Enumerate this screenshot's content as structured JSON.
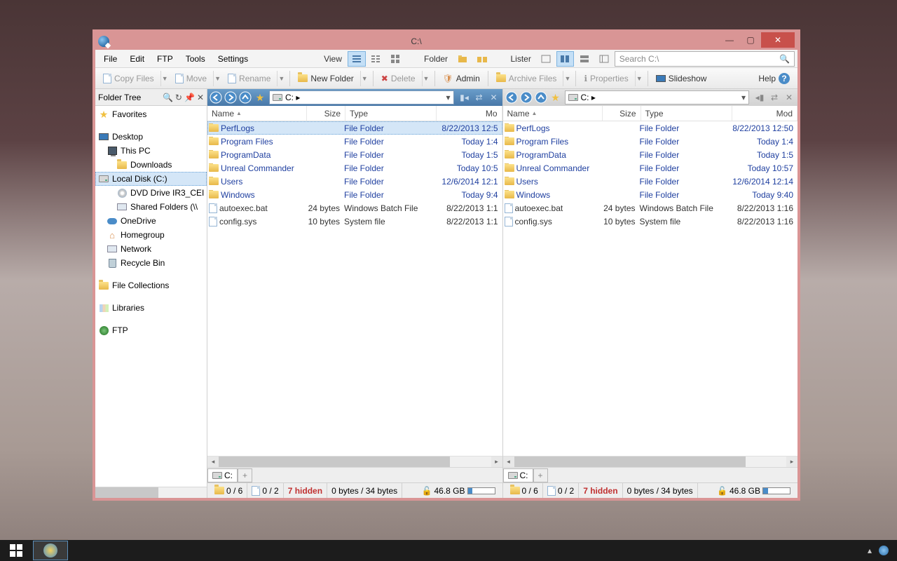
{
  "window": {
    "title": "C:\\"
  },
  "menubar": {
    "file": "File",
    "edit": "Edit",
    "ftp": "FTP",
    "tools": "Tools",
    "settings": "Settings",
    "view": "View",
    "folder": "Folder",
    "lister": "Lister"
  },
  "search": {
    "placeholder": "Search C:\\"
  },
  "toolbar": {
    "copy": "Copy Files",
    "move": "Move",
    "rename": "Rename",
    "newfolder": "New Folder",
    "delete": "Delete",
    "admin": "Admin",
    "archive": "Archive Files",
    "properties": "Properties",
    "slideshow": "Slideshow",
    "help": "Help"
  },
  "tree": {
    "header": "Folder Tree",
    "items": [
      {
        "label": "Favorites",
        "cls": "pad0",
        "icon": "star"
      },
      {
        "label": "",
        "cls": "blank"
      },
      {
        "label": "Desktop",
        "cls": "pad0",
        "icon": "desktop"
      },
      {
        "label": "This PC",
        "cls": "pad1",
        "icon": "pc"
      },
      {
        "label": "Downloads",
        "cls": "pad2",
        "icon": "folder"
      },
      {
        "label": "Local Disk (C:)",
        "cls": "pad2 sel",
        "icon": "drive"
      },
      {
        "label": "DVD Drive IR3_CEI",
        "cls": "pad2",
        "icon": "dvd"
      },
      {
        "label": "Shared Folders (\\\\",
        "cls": "pad2",
        "icon": "net"
      },
      {
        "label": "OneDrive",
        "cls": "pad1",
        "icon": "cloud"
      },
      {
        "label": "Homegroup",
        "cls": "pad1",
        "icon": "home"
      },
      {
        "label": "Network",
        "cls": "pad1",
        "icon": "net"
      },
      {
        "label": "Recycle Bin",
        "cls": "pad1",
        "icon": "bin"
      },
      {
        "label": "",
        "cls": "blank"
      },
      {
        "label": "File Collections",
        "cls": "pad0",
        "icon": "folder"
      },
      {
        "label": "",
        "cls": "blank"
      },
      {
        "label": "Libraries",
        "cls": "pad0",
        "icon": "lib"
      },
      {
        "label": "",
        "cls": "blank"
      },
      {
        "label": "FTP",
        "cls": "pad0",
        "icon": "ftp"
      }
    ]
  },
  "columns": {
    "name": "Name",
    "size": "Size",
    "type": "Type",
    "mod": "Mo"
  },
  "columns_r": {
    "mod": "Mod"
  },
  "address": "C: ▸",
  "files_left": [
    {
      "name": "PerfLogs",
      "size": "",
      "type": "File Folder",
      "mod": "8/22/2013  12:5",
      "folder": true,
      "link": true,
      "sel": true
    },
    {
      "name": "Program Files",
      "size": "",
      "type": "File Folder",
      "mod": "Today   1:4",
      "folder": true,
      "link": true
    },
    {
      "name": "ProgramData",
      "size": "",
      "type": "File Folder",
      "mod": "Today   1:5",
      "folder": true,
      "link": true
    },
    {
      "name": "Unreal Commander",
      "size": "",
      "type": "File Folder",
      "mod": "Today  10:5",
      "folder": true,
      "link": true
    },
    {
      "name": "Users",
      "size": "",
      "type": "File Folder",
      "mod": "12/6/2014  12:1",
      "folder": true,
      "link": true
    },
    {
      "name": "Windows",
      "size": "",
      "type": "File Folder",
      "mod": "Today   9:4",
      "folder": true,
      "link": true
    },
    {
      "name": "autoexec.bat",
      "size": "24 bytes",
      "type": "Windows Batch File",
      "mod": "8/22/2013   1:1",
      "folder": false,
      "link": false
    },
    {
      "name": "config.sys",
      "size": "10 bytes",
      "type": "System file",
      "mod": "8/22/2013   1:1",
      "folder": false,
      "link": false
    }
  ],
  "files_right": [
    {
      "name": "PerfLogs",
      "size": "",
      "type": "File Folder",
      "mod": "8/22/2013  12:50",
      "folder": true,
      "link": true
    },
    {
      "name": "Program Files",
      "size": "",
      "type": "File Folder",
      "mod": "Today   1:4",
      "folder": true,
      "link": true
    },
    {
      "name": "ProgramData",
      "size": "",
      "type": "File Folder",
      "mod": "Today   1:5",
      "folder": true,
      "link": true
    },
    {
      "name": "Unreal Commander",
      "size": "",
      "type": "File Folder",
      "mod": "Today  10:57",
      "folder": true,
      "link": true
    },
    {
      "name": "Users",
      "size": "",
      "type": "File Folder",
      "mod": "12/6/2014  12:14",
      "folder": true,
      "link": true
    },
    {
      "name": "Windows",
      "size": "",
      "type": "File Folder",
      "mod": "Today   9:40",
      "folder": true,
      "link": true
    },
    {
      "name": "autoexec.bat",
      "size": "24 bytes",
      "type": "Windows Batch File",
      "mod": "8/22/2013   1:16",
      "folder": false,
      "link": false
    },
    {
      "name": "config.sys",
      "size": "10 bytes",
      "type": "System file",
      "mod": "8/22/2013   1:16",
      "folder": false,
      "link": false
    }
  ],
  "tab": "C:",
  "status": {
    "folders": "0 / 6",
    "files": "0 / 2",
    "hidden": "7 hidden",
    "bytes": "0 bytes / 34 bytes",
    "disk": "46.8 GB"
  }
}
